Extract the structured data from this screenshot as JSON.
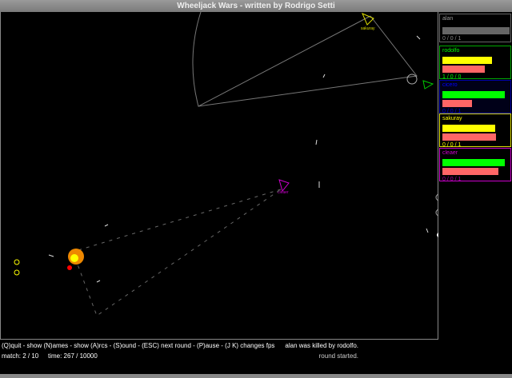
{
  "window": {
    "title": "Wheeljack Wars - written by Rodrigo Setti"
  },
  "players": [
    {
      "name": "alan",
      "color": "#888888",
      "score": "0 / 0 / 1",
      "health": 0,
      "energy": 0
    },
    {
      "name": "rodolfo",
      "color": "#00ff00",
      "score": "1 / 0 / 0",
      "health": 75,
      "energy": 65
    },
    {
      "name": "cicero",
      "color": "#0000ff",
      "score": "0 / 0 / 1",
      "health": 95,
      "energy": 45
    },
    {
      "name": "sakuray",
      "color": "#ffff00",
      "score": "0 / 0 / 1",
      "health": 80,
      "energy": 82
    },
    {
      "name": "cleaer",
      "color": "#cc00cc",
      "score": "0 / 0 / 1",
      "health": 95,
      "energy": 85
    }
  ],
  "status": {
    "help": "(Q)quit - show (N)ames - show (A)rcs - (S)ound - (ESC) next round - (P)ause - (J K) changes fps",
    "match": "match: 2 / 10",
    "time": "time: 267 / 10000",
    "messages": [
      "alan was killed by rodolfo.",
      "round started."
    ]
  },
  "arena_labels": {
    "yellow_tank": "sakuray",
    "green_tank": "rodolfo",
    "magenta_tank": "cleaer"
  }
}
